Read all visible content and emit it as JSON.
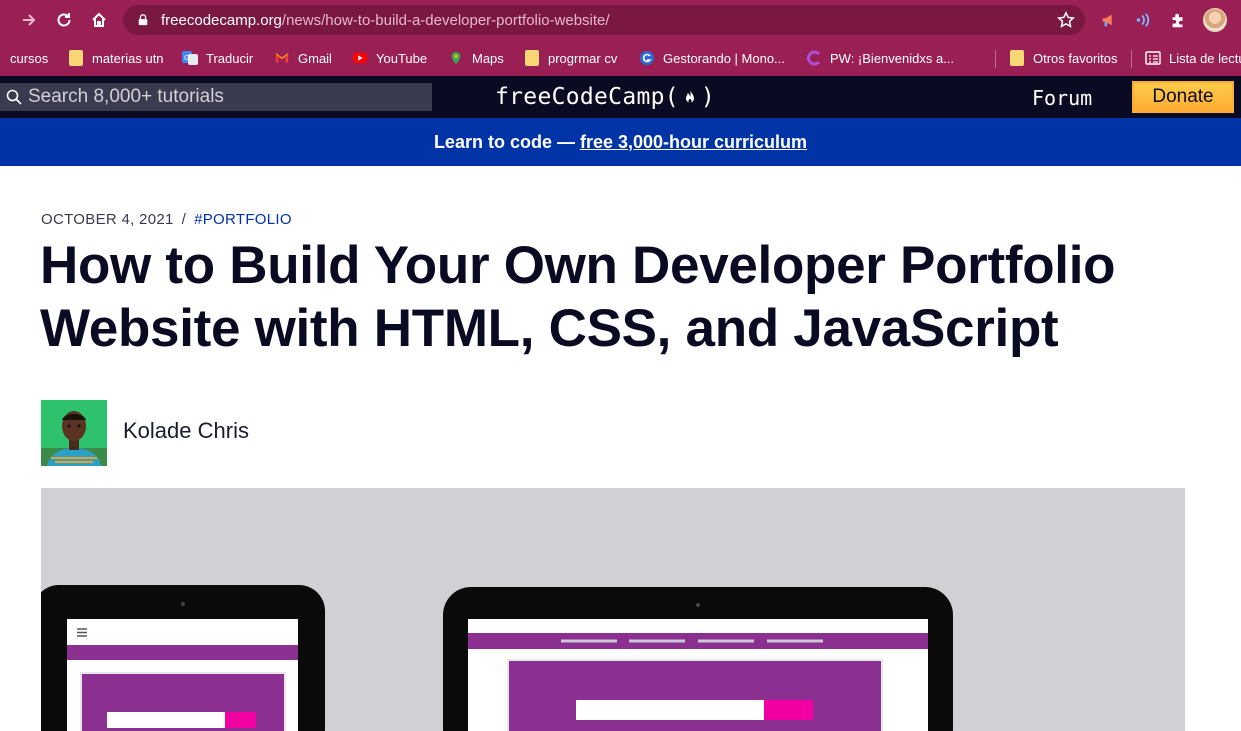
{
  "browser": {
    "url_host": "freecodecamp.org",
    "url_path": "/news/how-to-build-a-developer-portfolio-website/",
    "accent": "#9a1f55",
    "icons": [
      "forward-icon",
      "reload-icon",
      "home-icon",
      "lock-icon",
      "star-icon",
      "extensions-icon"
    ]
  },
  "bookmarks": [
    {
      "label": "cursos",
      "icon": "none"
    },
    {
      "label": "materias utn",
      "icon": "folder-icon"
    },
    {
      "label": "Traducir",
      "icon": "translate-icon"
    },
    {
      "label": "Gmail",
      "icon": "gmail-icon"
    },
    {
      "label": "YouTube",
      "icon": "youtube-icon"
    },
    {
      "label": "Maps",
      "icon": "maps-icon"
    },
    {
      "label": "progrmar cv",
      "icon": "folder-icon"
    },
    {
      "label": "Gestorando | Mono...",
      "icon": "gestorando-icon"
    },
    {
      "label": "PW: ¡Bienvenidxs a...",
      "icon": "pw-icon"
    },
    {
      "label": "Otros favoritos",
      "icon": "folder-icon"
    },
    {
      "label": "Lista de lectu",
      "icon": "reading-list-icon"
    }
  ],
  "fcc_nav": {
    "search_placeholder": "Search 8,000+ tutorials",
    "logo_left": "freeCodeCamp(",
    "logo_right": ")",
    "forum": "Forum",
    "donate": "Donate",
    "bg": "#0a0a23"
  },
  "banner": {
    "text": "Learn to code —",
    "link": "free 3,000-hour curriculum",
    "bg": "#0033a5"
  },
  "article": {
    "date": "OCTOBER 4, 2021",
    "separator": "/",
    "tag": "#PORTFOLIO",
    "title": "How to Build Your Own Developer Portfolio Website with HTML, CSS, and JavaScript",
    "author": "Kolade Chris"
  }
}
